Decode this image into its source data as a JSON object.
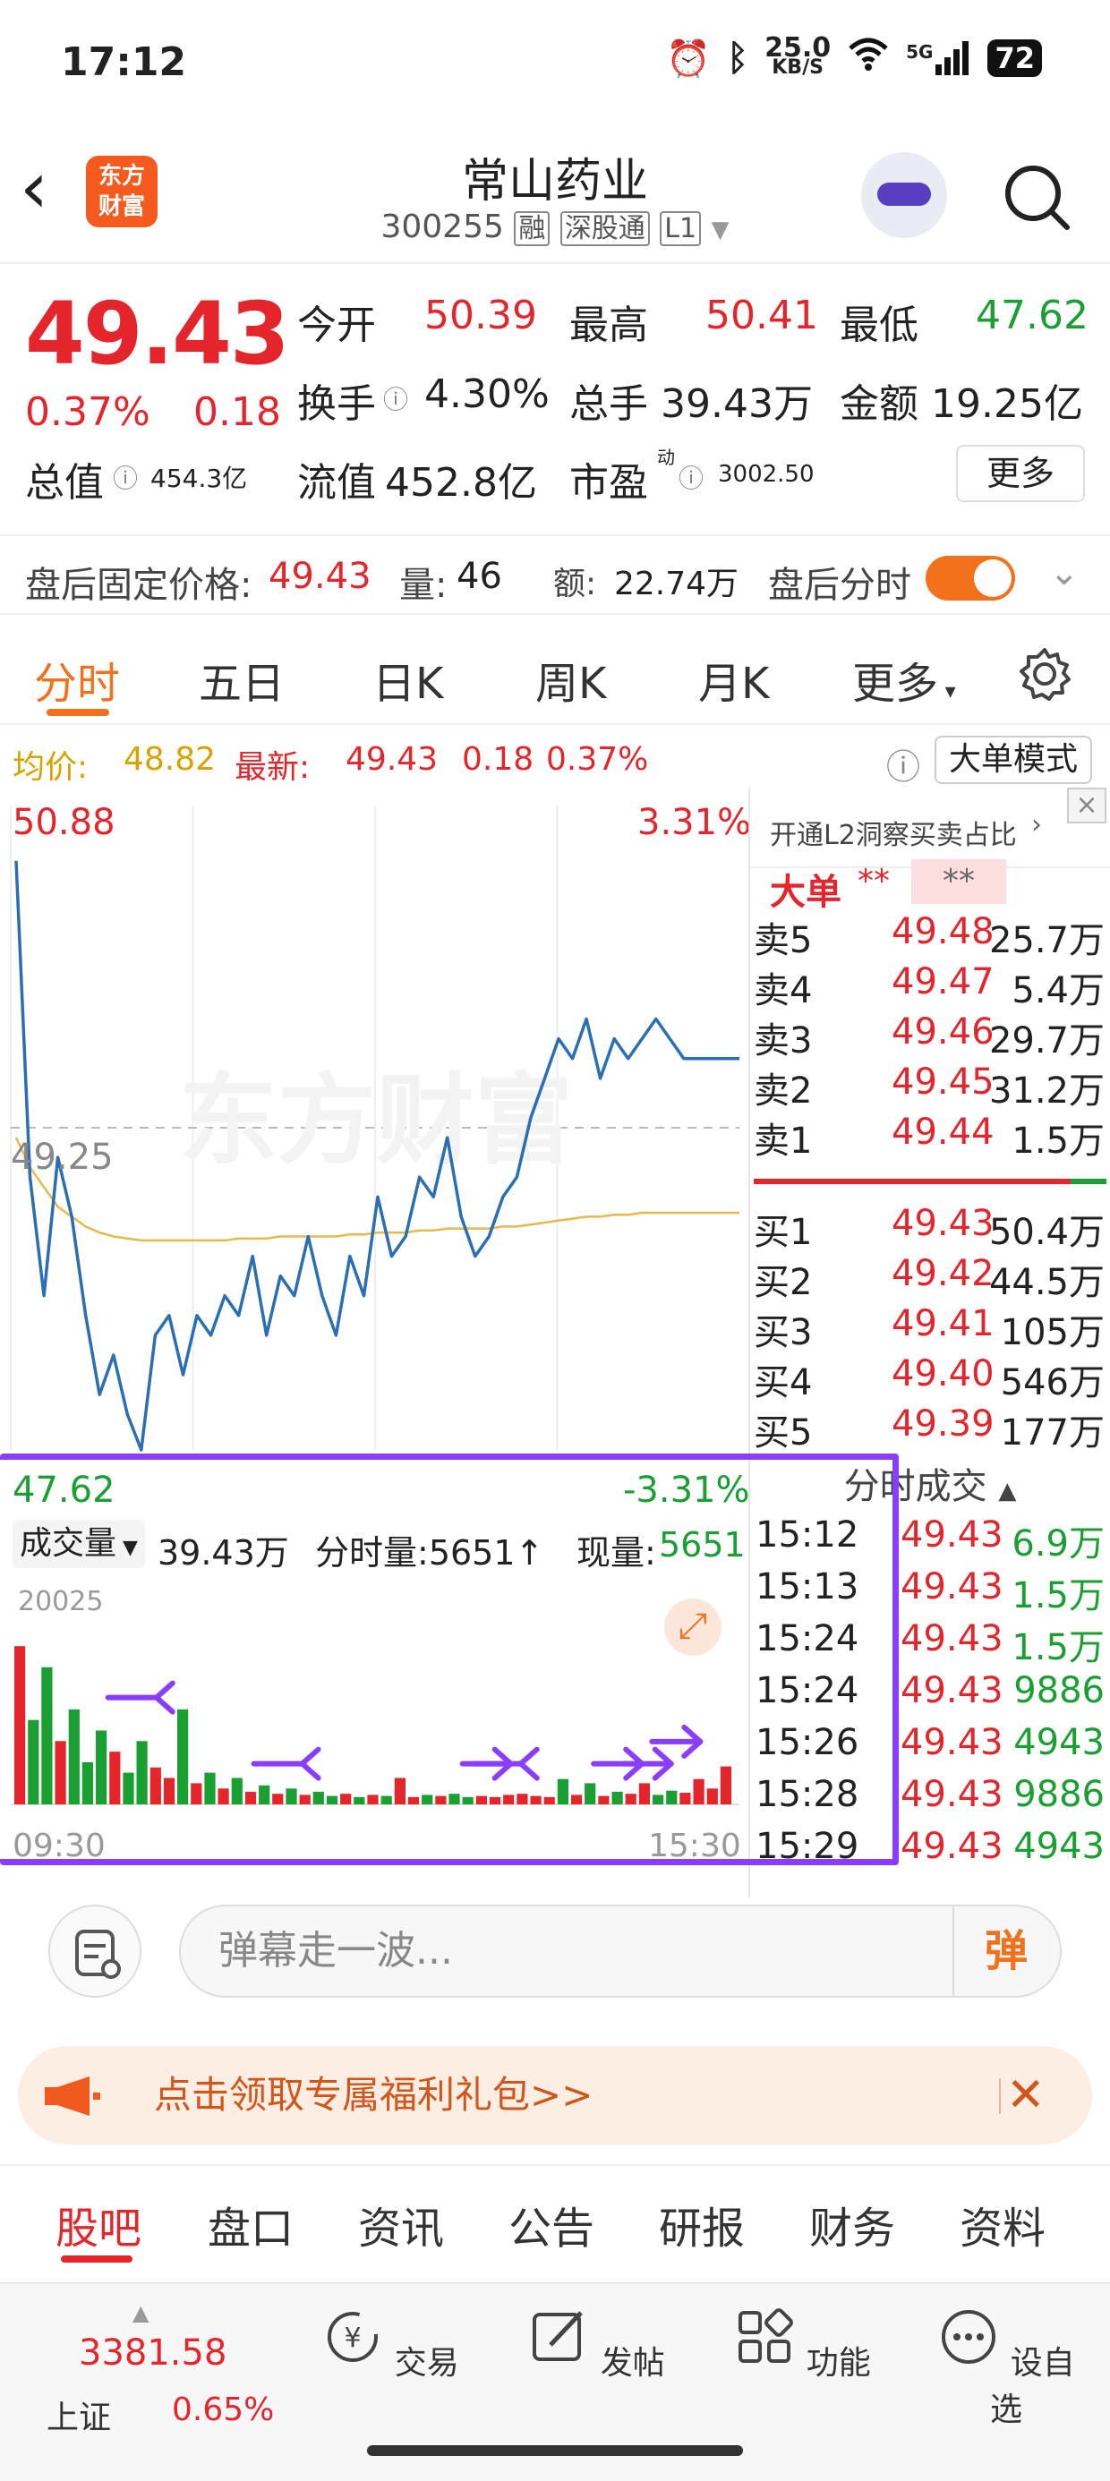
{
  "status_bar": {
    "time": "17:12",
    "net_speed_value": "25.0",
    "net_speed_unit": "KB/S",
    "signal_label": "5G",
    "battery": "72"
  },
  "header": {
    "app_logo_line1": "东方",
    "app_logo_line2": "财富",
    "stock_name": "常山药业",
    "stock_code": "300255",
    "tag_margin": "融",
    "tag_connect": "深股通",
    "tag_level": "L1"
  },
  "quote": {
    "price": "49.43",
    "change_pct": "0.37%",
    "change_amt": "0.18",
    "open_label": "今开",
    "open_value": "50.39",
    "high_label": "最高",
    "high_value": "50.41",
    "low_label": "最低",
    "low_value": "47.62",
    "turnover_label": "换手",
    "turnover_value": "4.30%",
    "volume_label": "总手",
    "volume_value": "39.43万",
    "amount_label": "金额",
    "amount_value": "19.25亿",
    "mktcap_label": "总值",
    "mktcap_value": "454.3亿",
    "float_label": "流值",
    "float_value": "452.8亿",
    "pe_label": "市盈",
    "pe_superscript": "动",
    "pe_value": "3002.50",
    "more_button": "更多"
  },
  "after_hours": {
    "price_label": "盘后固定价格:",
    "price_value": "49.43",
    "vol_label": "量:",
    "vol_value": "46",
    "amt_label": "额:",
    "amt_value": "22.74万",
    "minute_label": "盘后分时",
    "toggle_on": true
  },
  "chart_tabs": [
    "分时",
    "五日",
    "日K",
    "周K",
    "月K",
    "更多"
  ],
  "avg_bar": {
    "avg_label": "均价:",
    "avg_value": "48.82",
    "latest_label": "最新:",
    "latest_value": "49.43",
    "latest_change": "0.18",
    "latest_pct": "0.37%",
    "mode_button": "大单模式"
  },
  "chart_data": {
    "type": "line",
    "y_high_label": "50.88",
    "y_high_pct": "3.31%",
    "y_low_label": "47.62",
    "y_low_pct": "-3.31%",
    "prev_close_label": "49.25",
    "prev_close": 49.25,
    "ylim": [
      47.62,
      50.88
    ],
    "watermark": "东方财富",
    "x_start": "09:30",
    "x_end": "15:30",
    "series": [
      {
        "price": [
          50.6,
          49.0,
          48.4,
          49.1,
          48.8,
          48.3,
          47.9,
          48.1,
          47.8,
          47.62,
          48.2,
          48.3,
          48.0,
          48.3,
          48.2,
          48.4,
          48.3,
          48.6,
          48.2,
          48.5,
          48.4,
          48.7,
          48.4,
          48.2,
          48.6,
          48.4,
          48.9,
          48.6,
          48.7,
          49.0,
          48.9,
          49.2,
          48.8,
          48.6,
          48.7,
          48.9,
          49.0,
          49.3,
          49.5,
          49.7,
          49.6,
          49.8,
          49.5,
          49.7,
          49.6,
          49.7,
          49.8,
          49.7,
          49.6,
          49.6,
          49.6,
          49.6,
          49.6
        ],
        "avg": [
          49.2,
          49.05,
          48.95,
          48.85,
          48.8,
          48.75,
          48.72,
          48.7,
          48.69,
          48.68,
          48.68,
          48.68,
          48.68,
          48.68,
          48.68,
          48.68,
          48.69,
          48.69,
          48.69,
          48.7,
          48.7,
          48.7,
          48.7,
          48.7,
          48.71,
          48.71,
          48.72,
          48.72,
          48.72,
          48.73,
          48.73,
          48.74,
          48.74,
          48.74,
          48.74,
          48.75,
          48.75,
          48.76,
          48.77,
          48.78,
          48.79,
          48.8,
          48.8,
          48.81,
          48.81,
          48.82,
          48.82,
          48.82,
          48.82,
          48.82,
          48.82,
          48.82,
          48.82
        ]
      }
    ],
    "volume": {
      "label": "成交量",
      "total": "39.43万",
      "minute_label": "分时量:",
      "minute_value": "5651",
      "current_label": "现量:",
      "current_value": "5651",
      "max_label": "20025",
      "max": 20025,
      "bars": [
        15000,
        8000,
        13000,
        6000,
        9000,
        4000,
        7000,
        5000,
        3000,
        6000,
        3500,
        2500,
        9000,
        2000,
        3000,
        1500,
        2500,
        1200,
        1800,
        1000,
        1500,
        900,
        1200,
        800,
        1000,
        700,
        900,
        800,
        2500,
        700,
        900,
        800,
        1000,
        700,
        800,
        700,
        900,
        1000,
        800,
        700,
        2400,
        900,
        2000,
        800,
        1200,
        1000,
        2000,
        900,
        1300,
        1100,
        2400,
        1500,
        3600
      ]
    }
  },
  "order_book": {
    "promo": "开通L2洞察买卖占比",
    "big_order_label": "大单",
    "big_order_v1": "**",
    "big_order_v2": "**",
    "asks": [
      {
        "label": "卖5",
        "price": "49.48",
        "vol": "25.7万"
      },
      {
        "label": "卖4",
        "price": "49.47",
        "vol": "5.4万"
      },
      {
        "label": "卖3",
        "price": "49.46",
        "vol": "29.7万"
      },
      {
        "label": "卖2",
        "price": "49.45",
        "vol": "31.2万"
      },
      {
        "label": "卖1",
        "price": "49.44",
        "vol": "1.5万"
      }
    ],
    "bids": [
      {
        "label": "买1",
        "price": "49.43",
        "vol": "50.4万"
      },
      {
        "label": "买2",
        "price": "49.42",
        "vol": "44.5万"
      },
      {
        "label": "买3",
        "price": "49.41",
        "vol": "105万"
      },
      {
        "label": "买4",
        "price": "49.40",
        "vol": "546万"
      },
      {
        "label": "买5",
        "price": "49.39",
        "vol": "177万"
      }
    ],
    "trades_title": "分时成交",
    "trades": [
      {
        "time": "15:12",
        "price": "49.43",
        "vol": "6.9万"
      },
      {
        "time": "15:13",
        "price": "49.43",
        "vol": "1.5万"
      },
      {
        "time": "15:24",
        "price": "49.43",
        "vol": "1.5万"
      },
      {
        "time": "15:24",
        "price": "49.43",
        "vol": "9886"
      },
      {
        "time": "15:26",
        "price": "49.43",
        "vol": "4943"
      },
      {
        "time": "15:28",
        "price": "49.43",
        "vol": "9886"
      },
      {
        "time": "15:29",
        "price": "49.43",
        "vol": "4943"
      }
    ]
  },
  "danmaku": {
    "placeholder": "弹幕走一波...",
    "send_label": "弹"
  },
  "promo_banner": {
    "text": "点击领取专属福利礼包>>"
  },
  "bottom_tabs": [
    "股吧",
    "盘口",
    "资讯",
    "公告",
    "研报",
    "财务",
    "资料"
  ],
  "nav": {
    "index_value": "3381.58",
    "index_name": "上证",
    "index_pct": "0.65%",
    "items": [
      "交易",
      "发帖",
      "功能",
      "设自选"
    ]
  },
  "colors": {
    "up": "#e4262c",
    "down": "#1aa032",
    "accent": "#f2711c",
    "price_line": "#2a6fb4",
    "avg_line": "#e9b84a",
    "annotation": "#8b3dff"
  }
}
